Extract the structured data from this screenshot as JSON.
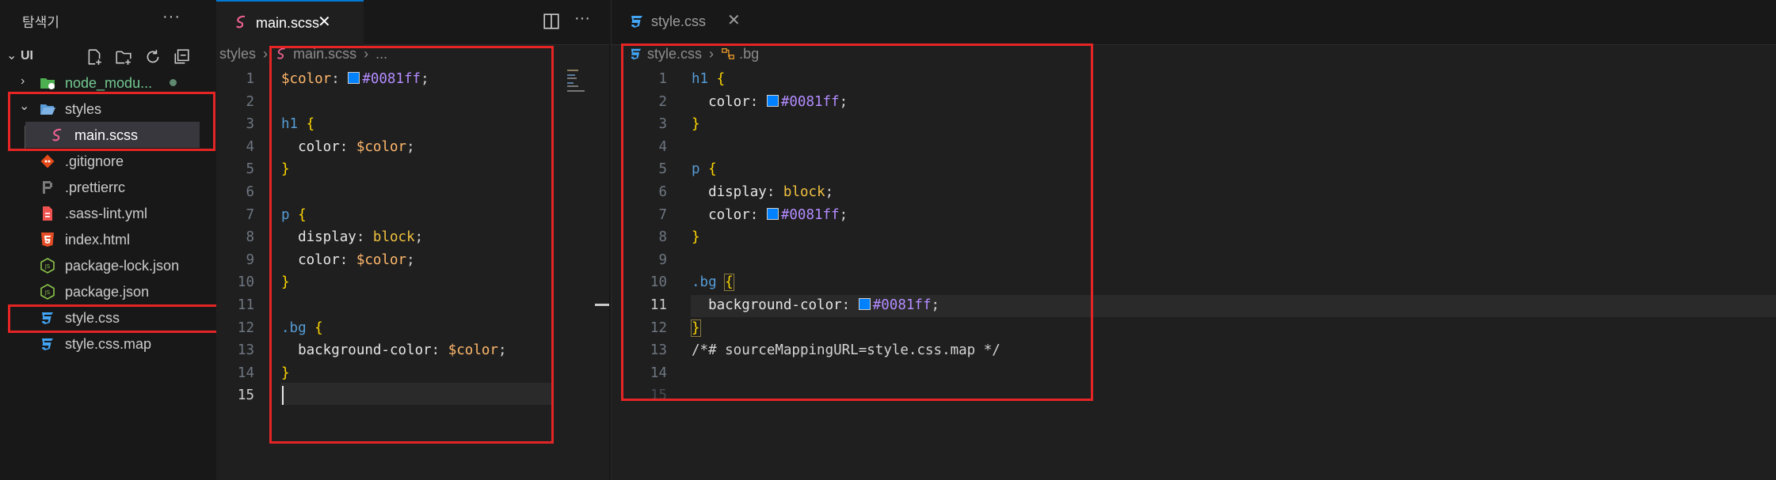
{
  "sidebar": {
    "title": "탐색기",
    "more": "···",
    "folder": "UI",
    "toolbar": [
      "new-file-icon",
      "new-folder-icon",
      "refresh-icon",
      "collapse-icon"
    ],
    "items": [
      {
        "label": "node_modu...",
        "icon": "folder-icon",
        "color": "#73c991"
      },
      {
        "label": "styles",
        "icon": "folder-open-icon",
        "color": "#cccccc"
      },
      {
        "label": "main.scss",
        "icon": "sass-icon",
        "color": "#ffffff"
      },
      {
        "label": ".gitignore",
        "icon": "git-icon",
        "color": "#cccccc"
      },
      {
        "label": ".prettierrc",
        "icon": "prettier-icon",
        "color": "#cccccc"
      },
      {
        "label": ".sass-lint.yml",
        "icon": "yaml-icon",
        "color": "#cccccc"
      },
      {
        "label": "index.html",
        "icon": "html-icon",
        "color": "#cccccc"
      },
      {
        "label": "package-lock.json",
        "icon": "node-icon",
        "color": "#cccccc"
      },
      {
        "label": "package.json",
        "icon": "node-icon",
        "color": "#cccccc"
      },
      {
        "label": "style.css",
        "icon": "css-icon",
        "color": "#cccccc"
      },
      {
        "label": "style.css.map",
        "icon": "css-icon",
        "color": "#cccccc"
      }
    ]
  },
  "left_editor": {
    "tab_label": "main.scss",
    "close": "✕",
    "breadcrumb_folder": "styles",
    "breadcrumb_file": "main.scss",
    "breadcrumb_more": "...",
    "line_numbers": [
      "1",
      "2",
      "3",
      "4",
      "5",
      "6",
      "7",
      "8",
      "9",
      "10",
      "11",
      "12",
      "13",
      "14",
      "15"
    ],
    "current_line": "15"
  },
  "right_editor": {
    "tab_label": "style.css",
    "close": "✕",
    "breadcrumb_file": "style.css",
    "breadcrumb_symbol": ".bg",
    "line_numbers": [
      "1",
      "2",
      "3",
      "4",
      "5",
      "6",
      "7",
      "8",
      "9",
      "10",
      "11",
      "12",
      "13",
      "14",
      "15"
    ],
    "current_line": "11",
    "comment": "/*# sourceMappingURL=style.css.map */"
  },
  "colors": {
    "accent": "#0081ff",
    "annotation": "#e52525"
  }
}
